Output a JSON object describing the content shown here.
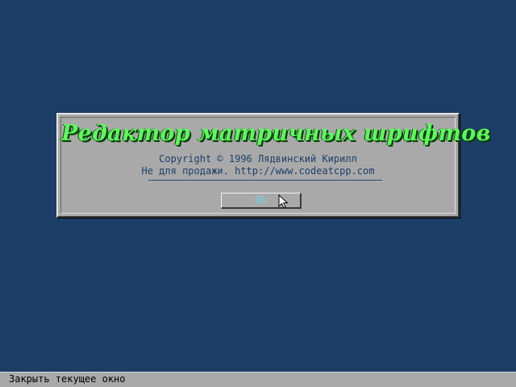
{
  "dialog": {
    "title": "Редактор матричных шрифтов",
    "copyright_line": "Copyright © 1996 Лядвинский Кирилл",
    "notice_line": "Не для продажи. http://www.codeatcpp.com",
    "ok_label": "Ok"
  },
  "statusbar": {
    "hint": "Закрыть текущее окно"
  },
  "colors": {
    "desktop": "#1c3d66",
    "panel": "#a9a9a9",
    "title_text": "#5cff5c",
    "body_text": "#1e3f6a",
    "ok_text": "#6ad9e8"
  },
  "icons": {
    "pointer": "mouse-pointer-icon"
  }
}
